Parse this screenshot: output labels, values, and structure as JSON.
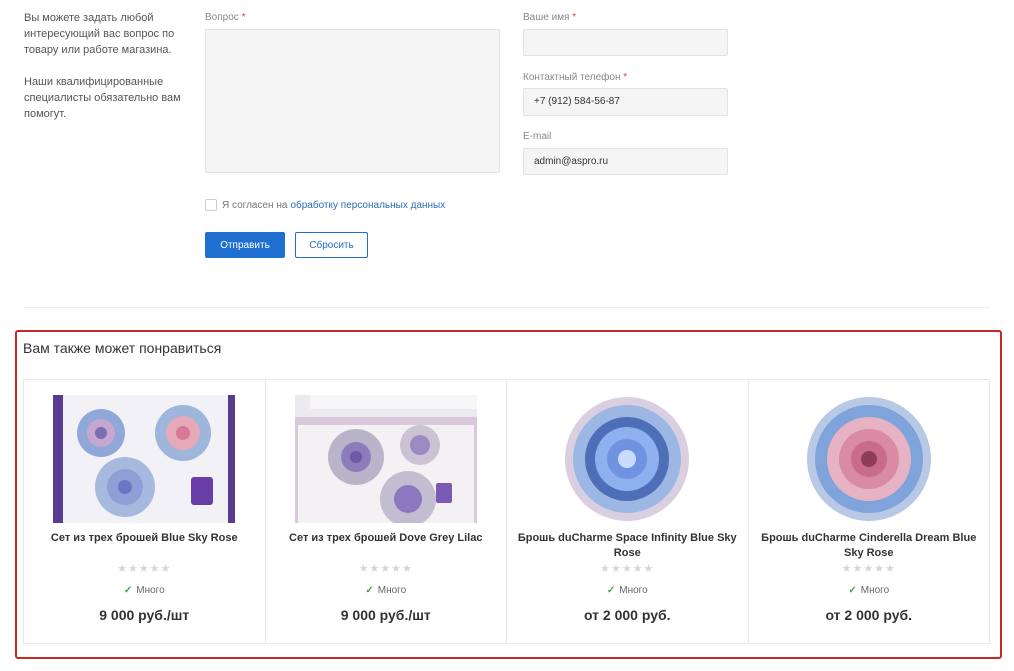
{
  "intro": {
    "p1": "Вы можете задать любой интересующий вас вопрос по товару или работе магазина.",
    "p2": "Наши квалифицированные специалисты обязательно вам помогут."
  },
  "form": {
    "question_label": "Вопрос",
    "required_mark": "*",
    "name_label": "Ваше имя",
    "name_value": "",
    "phone_label": "Контактный телефон",
    "phone_value": "+7 (912) 584-56-87",
    "email_label": "E-mail",
    "email_value": "admin@aspro.ru",
    "agree_text": "Я согласен на",
    "agree_link": "обработку персональных данных",
    "submit_label": "Отправить",
    "reset_label": "Сбросить"
  },
  "recommend": {
    "title": "Вам также может понравиться",
    "stars": "★★★★★",
    "check": "✓",
    "products": [
      {
        "name": "Сет из трех брошей Blue Sky Rose",
        "stock": "Много",
        "price": "9 000 руб./шт"
      },
      {
        "name": "Сет из трех брошей Dove Grey Lilac",
        "stock": "Много",
        "price": "9 000 руб./шт"
      },
      {
        "name": "Брошь duCharme Space Infinity Blue Sky Rose",
        "stock": "Много",
        "price": "от 2 000 руб."
      },
      {
        "name": "Брошь duCharme Cinderella Dream Blue Sky Rose",
        "stock": "Много",
        "price": "от 2 000 руб."
      }
    ]
  },
  "colors": {
    "accent": "#1f6fd0",
    "highlight": "#c62828",
    "in_stock": "#49a04b"
  }
}
